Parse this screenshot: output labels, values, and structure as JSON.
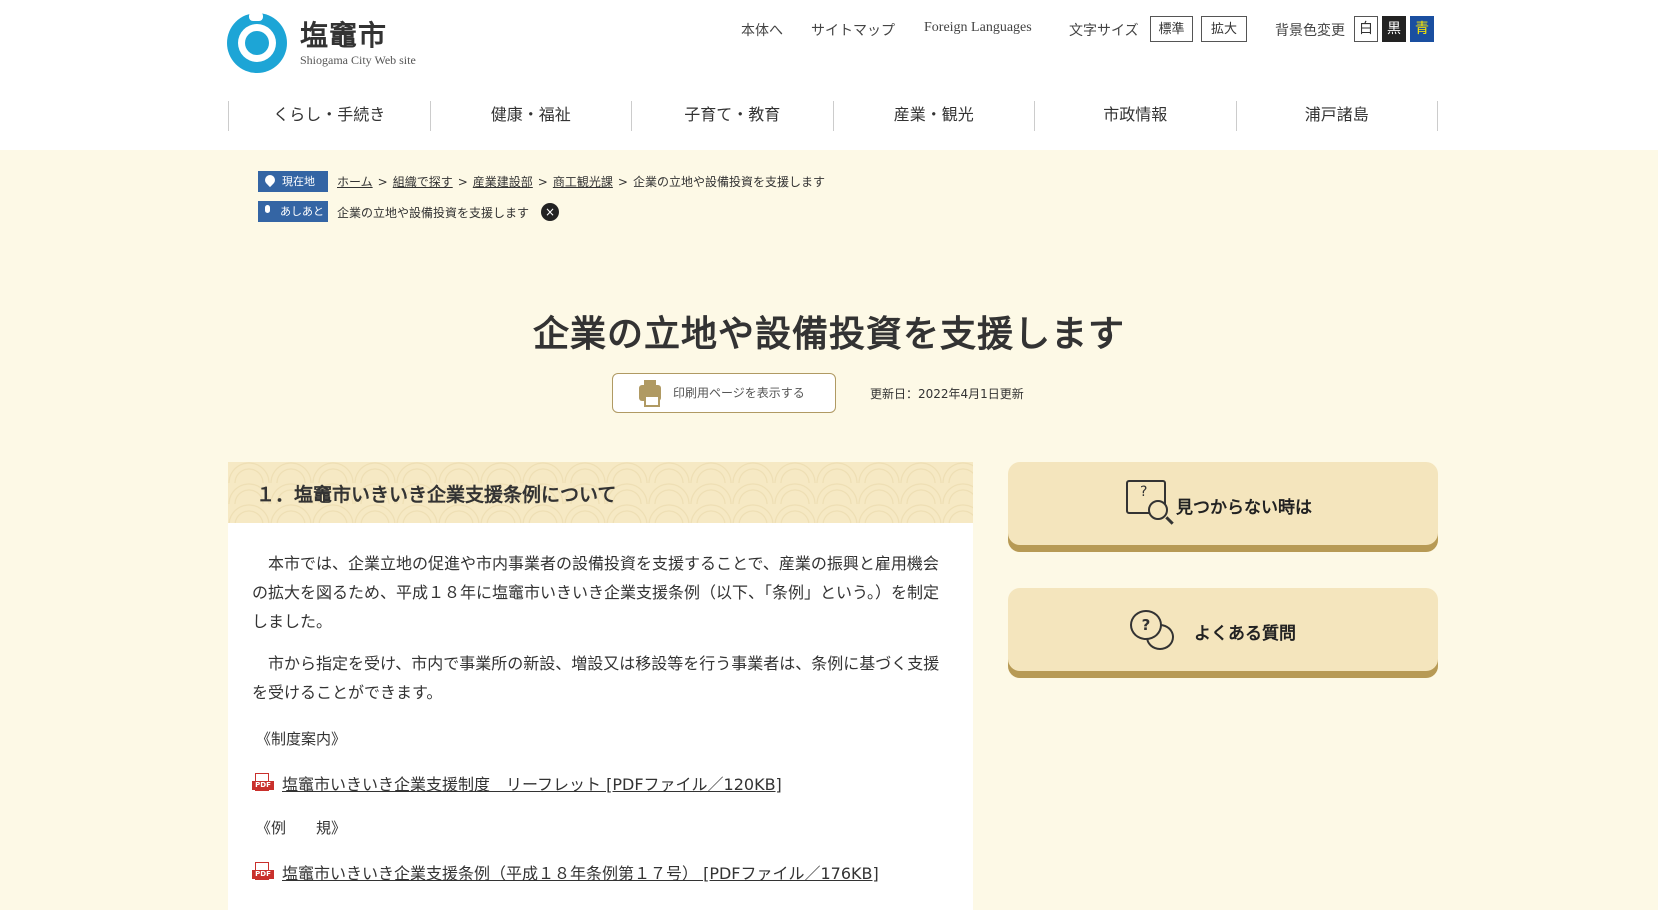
{
  "header": {
    "site_name": "塩竈市",
    "site_sub": "Shiogama City Web site",
    "links": {
      "home": "本体へ",
      "sitemap": "サイトマップ",
      "foreign": "Foreign Languages"
    },
    "font_size": {
      "label": "文字サイズ",
      "standard": "標準",
      "large": "拡大"
    },
    "bg_color": {
      "label": "背景色変更",
      "white": "白",
      "black": "黒",
      "blue": "青"
    }
  },
  "nav": {
    "items": [
      {
        "label": "くらし・手続き"
      },
      {
        "label": "健康・福祉"
      },
      {
        "label": "子育て・教育"
      },
      {
        "label": "産業・観光"
      },
      {
        "label": "市政情報"
      },
      {
        "label": "浦戸諸島"
      }
    ]
  },
  "breadcrumb": {
    "current_label": "現在地",
    "items": [
      "ホーム",
      "組織で探す",
      "産業建設部",
      "商工観光課"
    ],
    "current_page": "企業の立地や設備投資を支援します",
    "history_label": "あしあと",
    "history_item": "企業の立地や設備投資を支援します",
    "close": "×"
  },
  "page": {
    "title": "企業の立地や設備投資を支援します",
    "print_label": "印刷用ページを表示する",
    "updated": "更新日：2022年4月1日更新"
  },
  "section": {
    "heading": "１．塩竈市いきいき企業支援条例について",
    "para1": "本市では、企業立地の促進や市内事業者の設備投資を支援することで、産業の振興と雇用機会の拡大を図るため、平成１８年に塩竈市いきいき企業支援条例（以下、「条例」という。）を制定しました。",
    "para2": "市から指定を受け、市内で事業所の新設、増設又は移設等を行う事業者は、条例に基づく支援を受けることができます。",
    "sub1": "《制度案内》",
    "link1": "塩竈市いきいき企業支援制度　リーフレット [PDFファイル／120KB]",
    "sub2": "《例　　規》",
    "link2": "塩竈市いきいき企業支援条例（平成１８年条例第１７号） [PDFファイル／176KB]",
    "pdf_label": "PDF"
  },
  "sidebar": {
    "not_found": "見つからない時は",
    "faq": "よくある質問"
  },
  "colors": {
    "accent": "#1da5d6",
    "nav_blue": "#3465a4",
    "gold": "#b79a55",
    "cream": "#fdf9e6"
  }
}
